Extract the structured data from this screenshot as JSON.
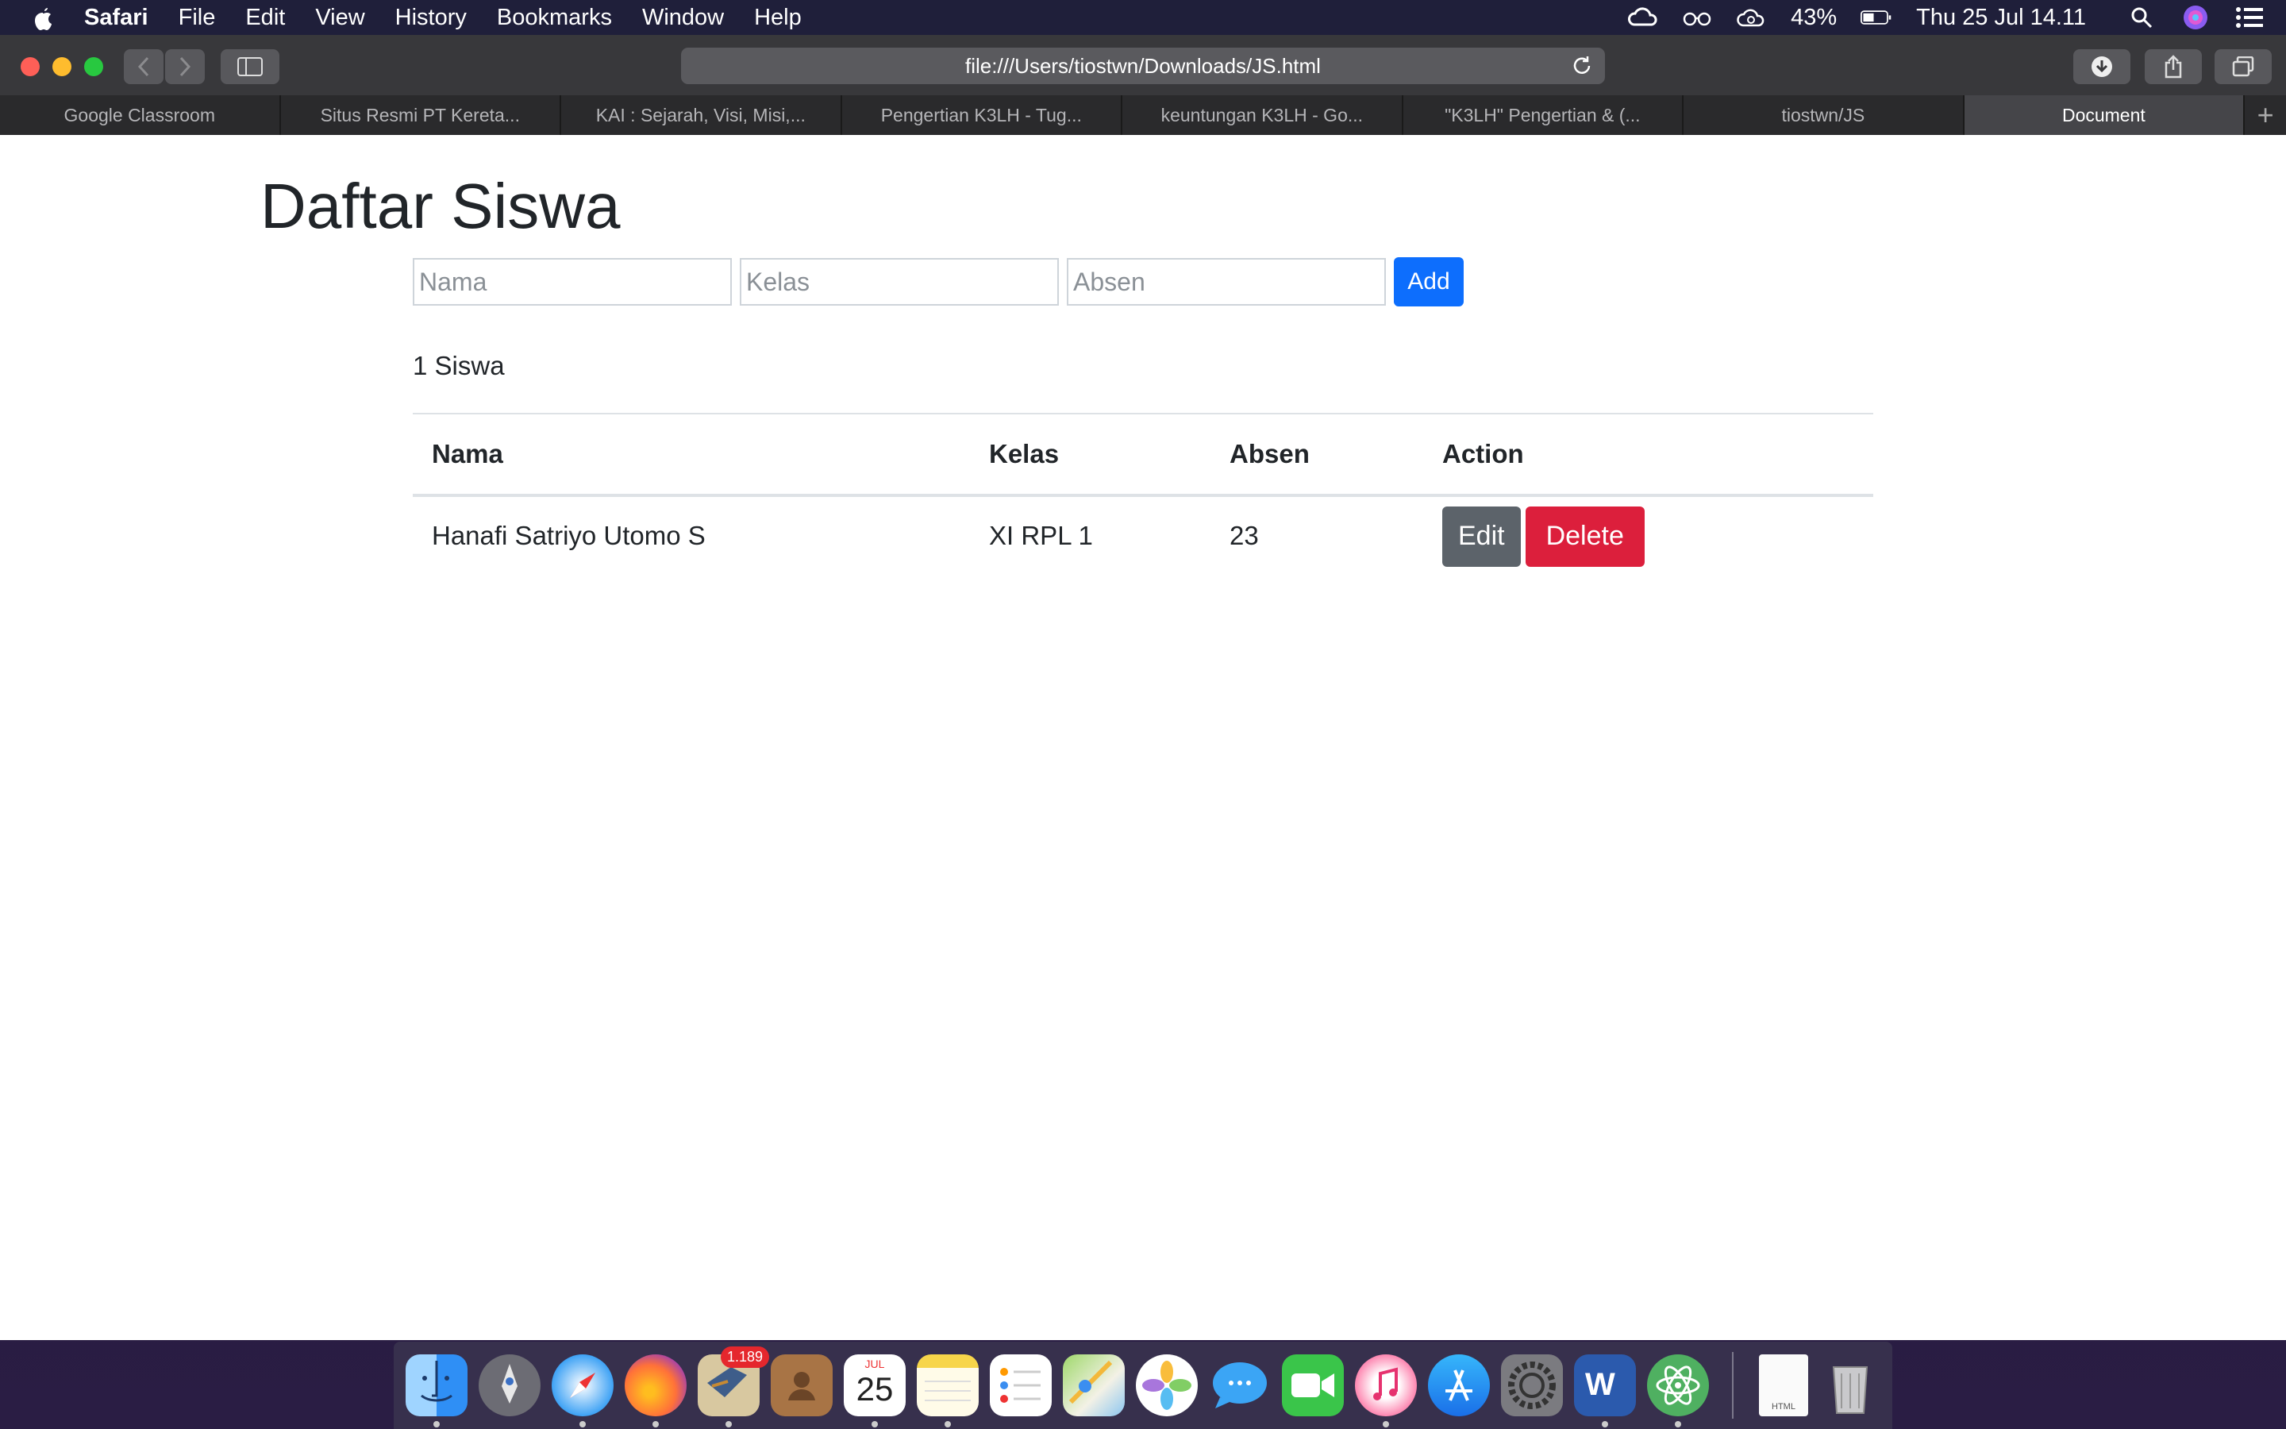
{
  "menubar": {
    "app_name": "Safari",
    "items": [
      "File",
      "Edit",
      "View",
      "History",
      "Bookmarks",
      "Window",
      "Help"
    ],
    "battery": "43%",
    "datetime": "Thu 25 Jul  14.11"
  },
  "browser": {
    "url": "file:///Users/tiostwn/Downloads/JS.html",
    "tabs": [
      "Google Classroom",
      "Situs Resmi PT Kereta...",
      "KAI : Sejarah, Visi, Misi,...",
      "Pengertian K3LH - Tug...",
      "keuntungan K3LH - Go...",
      "\"K3LH\" Pengertian & (...",
      "tiostwn/JS",
      "Document"
    ],
    "new_tab": "+"
  },
  "page": {
    "title": "Daftar Siswa",
    "form": {
      "nama_placeholder": "Nama",
      "kelas_placeholder": "Kelas",
      "absen_placeholder": "Absen",
      "add_label": "Add"
    },
    "count": "1 Siswa",
    "table": {
      "headers": [
        "Nama",
        "Kelas",
        "Absen",
        "Action"
      ],
      "rows": [
        {
          "nama": "Hanafi Satriyo Utomo S",
          "kelas": "XI RPL 1",
          "absen": "23",
          "edit": "Edit",
          "delete": "Delete"
        }
      ]
    }
  },
  "dock": {
    "apps": [
      "finder-icon",
      "launchpad-icon",
      "safari-icon",
      "firefox-icon",
      "mail-icon",
      "contacts-icon",
      "calendar-icon",
      "notes-icon",
      "reminders-icon",
      "maps-icon",
      "photos-icon",
      "messages-icon",
      "facetime-icon",
      "itunes-icon",
      "app-store-icon",
      "system-preferences-icon",
      "word-icon",
      "atom-icon"
    ],
    "mail_badge": "1.189",
    "calendar_month": "JUL",
    "calendar_day": "25",
    "word_letter": "W",
    "doc_label": "HTML"
  }
}
